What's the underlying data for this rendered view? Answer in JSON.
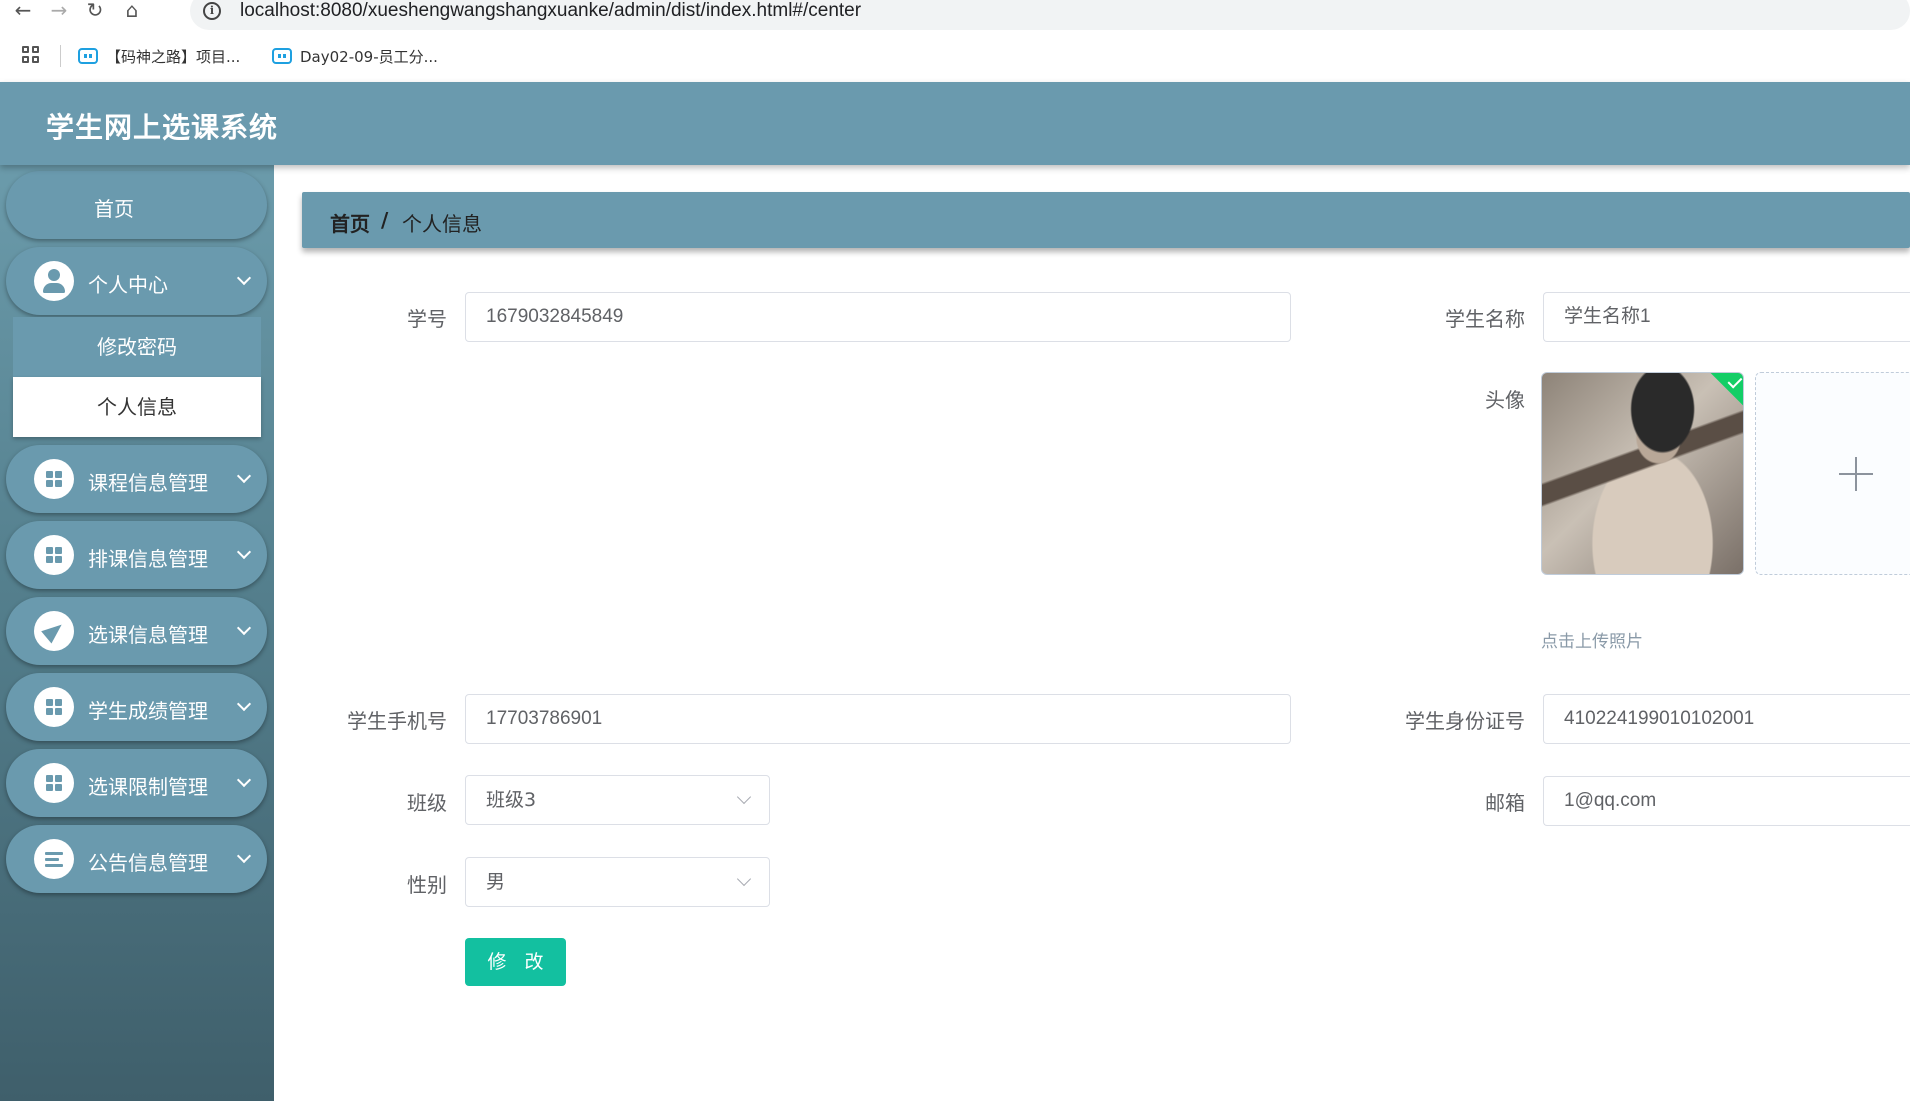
{
  "browser": {
    "url": "localhost:8080/xueshengwangshangxuanke/admin/dist/index.html#/center",
    "bookmarks": [
      "【码神之路】项目...",
      "Day02-09-员工分..."
    ]
  },
  "app": {
    "title": "学生网上选课系统"
  },
  "sidebar": {
    "home": "首页",
    "items": [
      {
        "label": "个人中心",
        "icon": "user-icon"
      },
      {
        "label": "课程信息管理",
        "icon": "grid-icon"
      },
      {
        "label": "排课信息管理",
        "icon": "grid-icon"
      },
      {
        "label": "选课信息管理",
        "icon": "send-icon"
      },
      {
        "label": "学生成绩管理",
        "icon": "grid-icon"
      },
      {
        "label": "选课限制管理",
        "icon": "grid-icon"
      },
      {
        "label": "公告信息管理",
        "icon": "list-icon"
      }
    ],
    "submenu": [
      "修改密码",
      "个人信息"
    ]
  },
  "breadcrumb": {
    "home": "首页",
    "separator": "/",
    "current": "个人信息"
  },
  "form": {
    "student_no": {
      "label": "学号",
      "value": "1679032845849"
    },
    "student_name": {
      "label": "学生名称",
      "value": "学生名称1"
    },
    "avatar": {
      "label": "头像",
      "tip": "点击上传照片"
    },
    "phone": {
      "label": "学生手机号",
      "value": "17703786901"
    },
    "id_card": {
      "label": "学生身份证号",
      "value": "410224199010102001"
    },
    "class": {
      "label": "班级",
      "value": "班级3"
    },
    "email": {
      "label": "邮箱",
      "value": "1@qq.com"
    },
    "gender": {
      "label": "性别",
      "value": "男"
    },
    "submit": "修 改"
  },
  "colors": {
    "theme": "#6a9aae",
    "submit": "#13c0a0",
    "success": "#13ce66"
  }
}
